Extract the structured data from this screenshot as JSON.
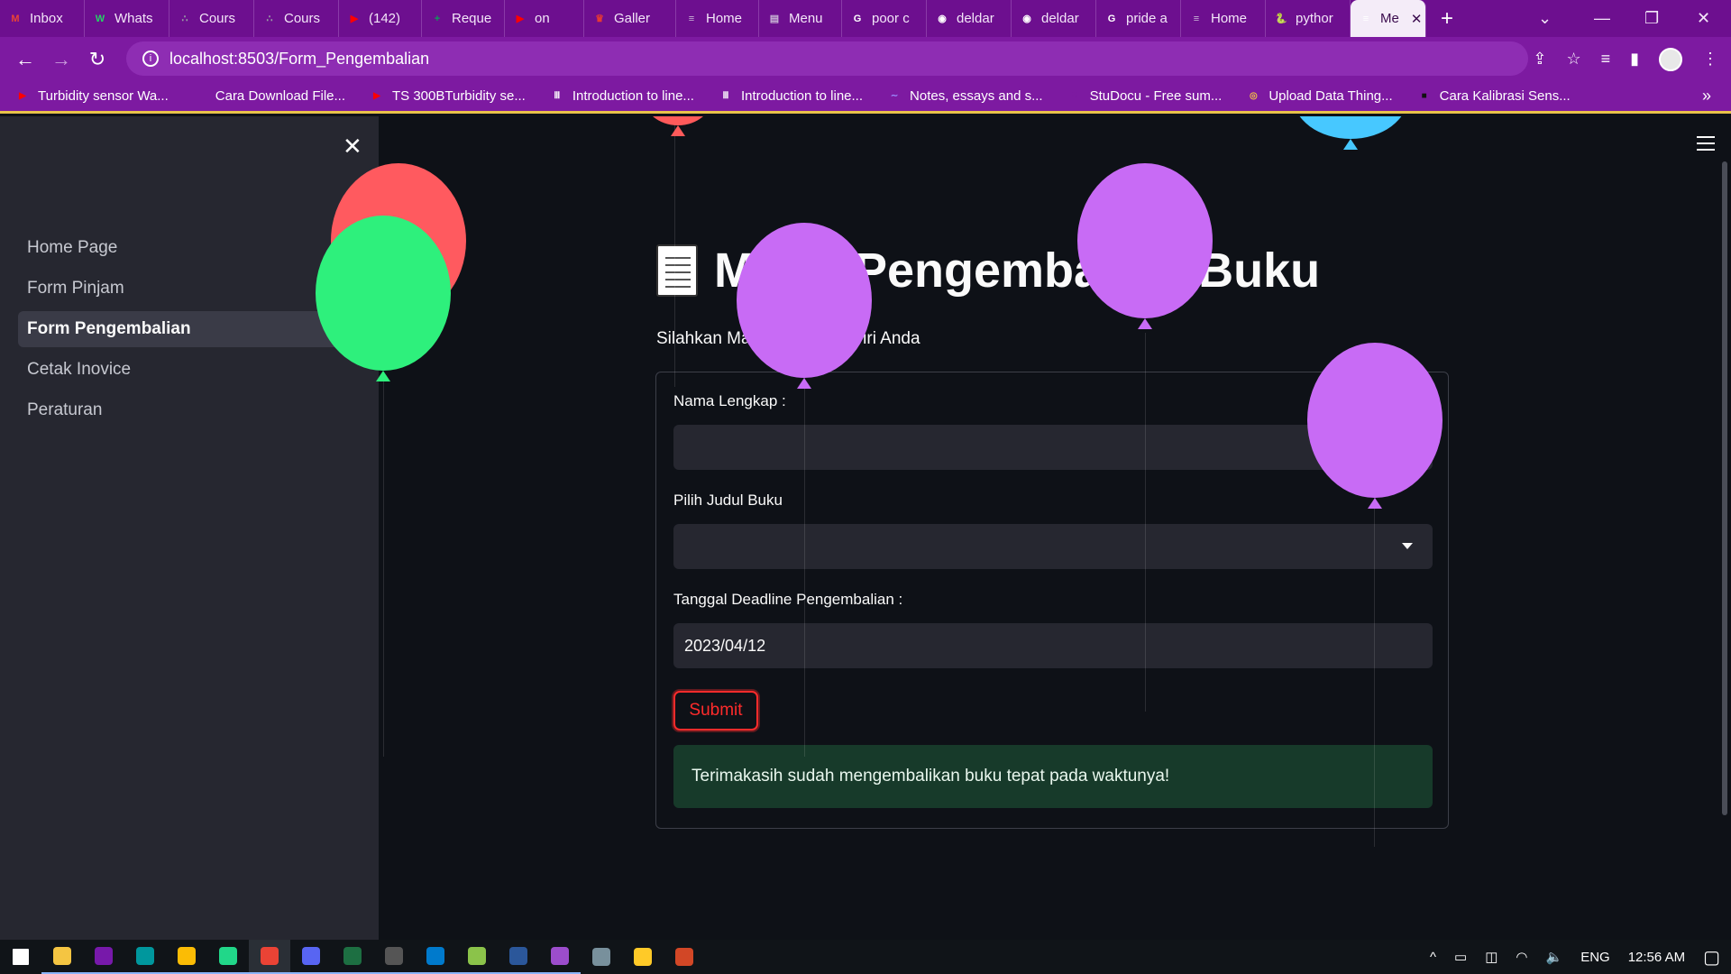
{
  "browser": {
    "tabs": [
      {
        "label": "Inbox",
        "icon": "gmail-icon",
        "color": "#ea4335",
        "glyph": "M"
      },
      {
        "label": "Whats",
        "icon": "whatsapp-icon",
        "color": "#25d366",
        "glyph": "W"
      },
      {
        "label": "Cours",
        "icon": "cisco-icon",
        "color": "#9aa0a6",
        "glyph": "∴"
      },
      {
        "label": "Cours",
        "icon": "cisco-icon",
        "color": "#9aa0a6",
        "glyph": "∴"
      },
      {
        "label": "(142)",
        "icon": "youtube-icon",
        "color": "#ff0000",
        "glyph": "▶"
      },
      {
        "label": "Reque",
        "icon": "sheets-plus-icon",
        "color": "#0f9d58",
        "glyph": "+"
      },
      {
        "label": "on",
        "icon": "youtube-music-icon",
        "color": "#ff0000",
        "glyph": "▶"
      },
      {
        "label": "Galler",
        "icon": "crown-icon",
        "color": "#e53935",
        "glyph": "♛"
      },
      {
        "label": "Home",
        "icon": "page-icon",
        "color": "#c9b6d6",
        "glyph": "≡"
      },
      {
        "label": "Menu",
        "icon": "book-icon",
        "color": "#c9b6d6",
        "glyph": "▤"
      },
      {
        "label": "poor c",
        "icon": "google-icon",
        "color": "#ffffff",
        "glyph": "G"
      },
      {
        "label": "deldar",
        "icon": "github-icon",
        "color": "#ffffff",
        "glyph": "◉"
      },
      {
        "label": "deldar",
        "icon": "github-icon",
        "color": "#ffffff",
        "glyph": "◉"
      },
      {
        "label": "pride a",
        "icon": "google-icon",
        "color": "#ffffff",
        "glyph": "G"
      },
      {
        "label": "Home",
        "icon": "page-icon",
        "color": "#c9b6d6",
        "glyph": "≡"
      },
      {
        "label": "pythor",
        "icon": "python-icon",
        "color": "#f7a823",
        "glyph": "🐍"
      },
      {
        "label": "Me",
        "icon": "doc-icon",
        "color": "#ffffff",
        "glyph": "≡"
      }
    ],
    "url": "localhost:8503/Form_Pengembalian",
    "bookmarks": [
      {
        "label": "Turbidity sensor Wa...",
        "icon": "youtube-icon",
        "color": "#ff0000",
        "glyph": "▶"
      },
      {
        "label": "Cara Download File...",
        "icon": "blank-icon",
        "color": "#7d1aa1",
        "glyph": ""
      },
      {
        "label": "TS 300BTurbidity se...",
        "icon": "youtube-icon",
        "color": "#ff0000",
        "glyph": "▶"
      },
      {
        "label": "Introduction to line...",
        "icon": "institution-icon",
        "color": "#ffffff",
        "glyph": "Ⅲ"
      },
      {
        "label": "Introduction to line...",
        "icon": "institution-icon",
        "color": "#ffffff",
        "glyph": "Ⅲ"
      },
      {
        "label": "Notes, essays and s...",
        "icon": "wave-icon",
        "color": "#9b8cff",
        "glyph": "∼"
      },
      {
        "label": "StuDocu - Free sum...",
        "icon": "studocu-icon",
        "color": "#7d1aa1",
        "glyph": "S"
      },
      {
        "label": "Upload Data Thing...",
        "icon": "thingspeak-icon",
        "color": "#f5c542",
        "glyph": "◎"
      },
      {
        "label": "Cara Kalibrasi Sens...",
        "icon": "flag-icon",
        "color": "#111111",
        "glyph": "■"
      }
    ]
  },
  "sidebar": {
    "items": [
      {
        "label": "Home Page",
        "active": false
      },
      {
        "label": "Form Pinjam",
        "active": false
      },
      {
        "label": "Form Pengembalian",
        "active": true
      },
      {
        "label": "Cetak Inovice",
        "active": false
      },
      {
        "label": "Peraturan",
        "active": false
      }
    ]
  },
  "main": {
    "title": "Menu Pengembalian Buku",
    "subtitle": "Silahkan Masukkan Data Diri Anda",
    "form": {
      "name_label": "Nama Lengkap :",
      "name_value": "",
      "book_label": "Pilih Judul Buku",
      "book_value": "",
      "date_label": "Tanggal Deadline Pengembalian :",
      "date_value": "2023/04/12",
      "submit_label": "Submit",
      "success_message": "Terimakasih sudah mengembalikan buku tepat pada waktunya!"
    }
  },
  "colors": {
    "accent": "#ff2b2b",
    "success_bg": "#173a2a",
    "sidebar_bg": "#262730",
    "app_bg": "#0e1117",
    "browser_theme": "#7d1aa1"
  },
  "taskbar": {
    "apps": [
      {
        "icon": "windows-start-icon",
        "color": "#ffffff"
      },
      {
        "icon": "file-explorer-icon",
        "color": "#f4c542"
      },
      {
        "icon": "onenote-icon",
        "color": "#7719aa"
      },
      {
        "icon": "arduino-icon",
        "color": "#00979d"
      },
      {
        "icon": "chrome-icon",
        "color": "#fbbc05"
      },
      {
        "icon": "webstorm-icon",
        "color": "#21d789"
      },
      {
        "icon": "chrome-active-icon",
        "color": "#ea4335"
      },
      {
        "icon": "discord-icon",
        "color": "#5865f2"
      },
      {
        "icon": "excel-icon",
        "color": "#1d6f42"
      },
      {
        "icon": "terminal-icon",
        "color": "#555555"
      },
      {
        "icon": "vscode-icon",
        "color": "#007acc"
      },
      {
        "icon": "notepad-icon",
        "color": "#8bc34a"
      },
      {
        "icon": "word-icon",
        "color": "#2b579a"
      },
      {
        "icon": "github-desktop-icon",
        "color": "#9c4dcc"
      },
      {
        "icon": "app-icon",
        "color": "#78909c"
      },
      {
        "icon": "paint-icon",
        "color": "#ffca28"
      },
      {
        "icon": "powerpoint-icon",
        "color": "#d24726"
      }
    ],
    "language": "ENG",
    "time": "12:56 AM"
  }
}
